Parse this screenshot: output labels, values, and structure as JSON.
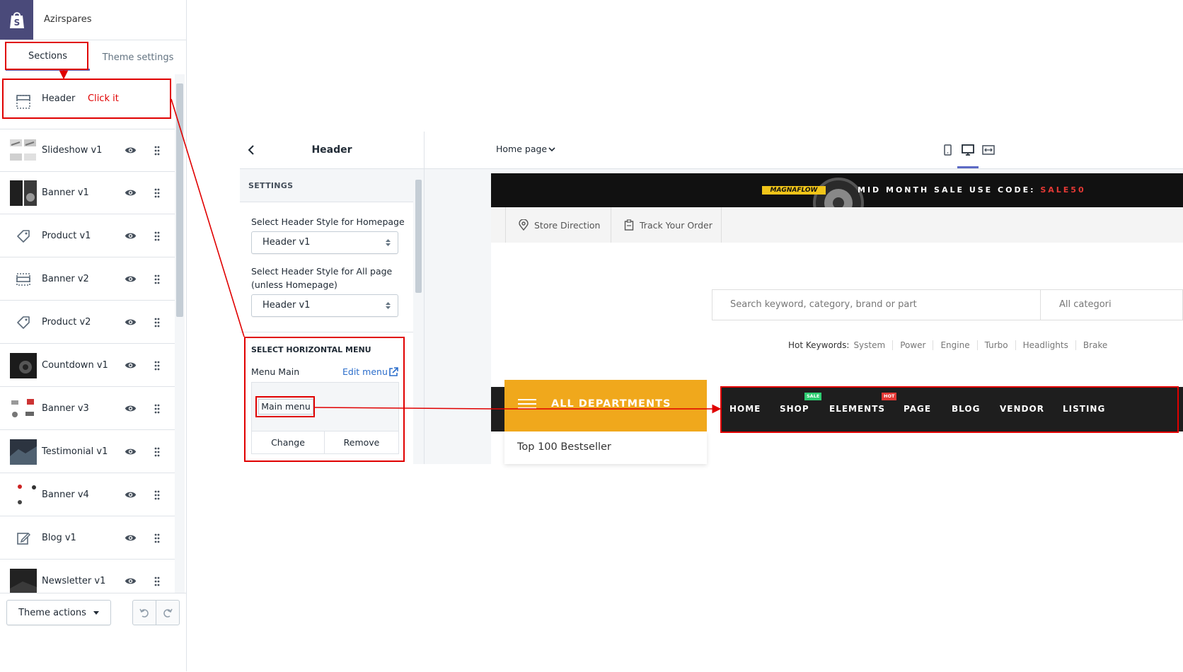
{
  "app": {
    "store_name": "Azirspares",
    "logo_icon": "shopify-bag-icon"
  },
  "tabs": {
    "sections": "Sections",
    "theme_settings": "Theme settings"
  },
  "sections": [
    {
      "label": "Header",
      "icon": "header-layout-icon",
      "annotation": "Click it"
    },
    {
      "label": "Slideshow v1",
      "icon": "slideshow-thumbnail"
    },
    {
      "label": "Banner v1",
      "icon": "banner-thumbnail"
    },
    {
      "label": "Product v1",
      "icon": "tag-icon"
    },
    {
      "label": "Banner v2",
      "icon": "banner-layout-icon"
    },
    {
      "label": "Product v2",
      "icon": "tag-icon"
    },
    {
      "label": "Countdown v1",
      "icon": "countdown-thumbnail"
    },
    {
      "label": "Banner v3",
      "icon": "banner-thumbnail"
    },
    {
      "label": "Testimonial v1",
      "icon": "testimonial-thumbnail"
    },
    {
      "label": "Banner v4",
      "icon": "banner-thumbnail"
    },
    {
      "label": "Blog v1",
      "icon": "edit-icon"
    },
    {
      "label": "Newsletter v1",
      "icon": "newsletter-thumbnail"
    }
  ],
  "footer": {
    "theme_actions": "Theme actions"
  },
  "panel": {
    "title": "Header",
    "settings_heading": "SETTINGS",
    "homepage_style_label": "Select Header Style for Homepage",
    "homepage_style_value": "Header v1",
    "allpage_style_label_1": "Select Header Style for All page",
    "allpage_style_label_2": "(unless Homepage)",
    "allpage_style_value": "Header v1",
    "menu_heading": "SELECT HORIZONTAL MENU",
    "menu_label": "Menu Main",
    "edit_menu": "Edit menu",
    "menu_value": "Main menu",
    "change": "Change",
    "remove": "Remove"
  },
  "preview": {
    "page_select": "Home page",
    "devices": [
      "mobile-icon",
      "desktop-icon",
      "fullwidth-icon"
    ],
    "active_device": "desktop-icon"
  },
  "store": {
    "brand": "MAGNAFLOW",
    "promo_text": "MID MONTH SALE USE CODE: ",
    "promo_code": "SALE50",
    "store_direction": "Store Direction",
    "track_order": "Track Your Order",
    "search_placeholder": "Search keyword, category, brand or part",
    "search_category": "All categori",
    "hot_keywords_label": "Hot Keywords:",
    "hot_keywords": [
      "System",
      "Power",
      "Engine",
      "Turbo",
      "Headlights",
      "Brake"
    ],
    "all_departments": "ALL DEPARTMENTS",
    "top100": "Top 100 Bestseller",
    "nav": [
      "HOME",
      "SHOP",
      "ELEMENTS",
      "PAGE",
      "BLOG",
      "VENDOR",
      "LISTING"
    ],
    "badge_sale": "SALE",
    "badge_hot": "HOT"
  },
  "colors": {
    "accent": "#5c6ac4",
    "annotation_red": "#e00000",
    "department_yellow": "#f0a81c",
    "nav_dark": "#1e1e1e",
    "sale_green": "#2ecc71",
    "hot_red": "#e53935"
  }
}
